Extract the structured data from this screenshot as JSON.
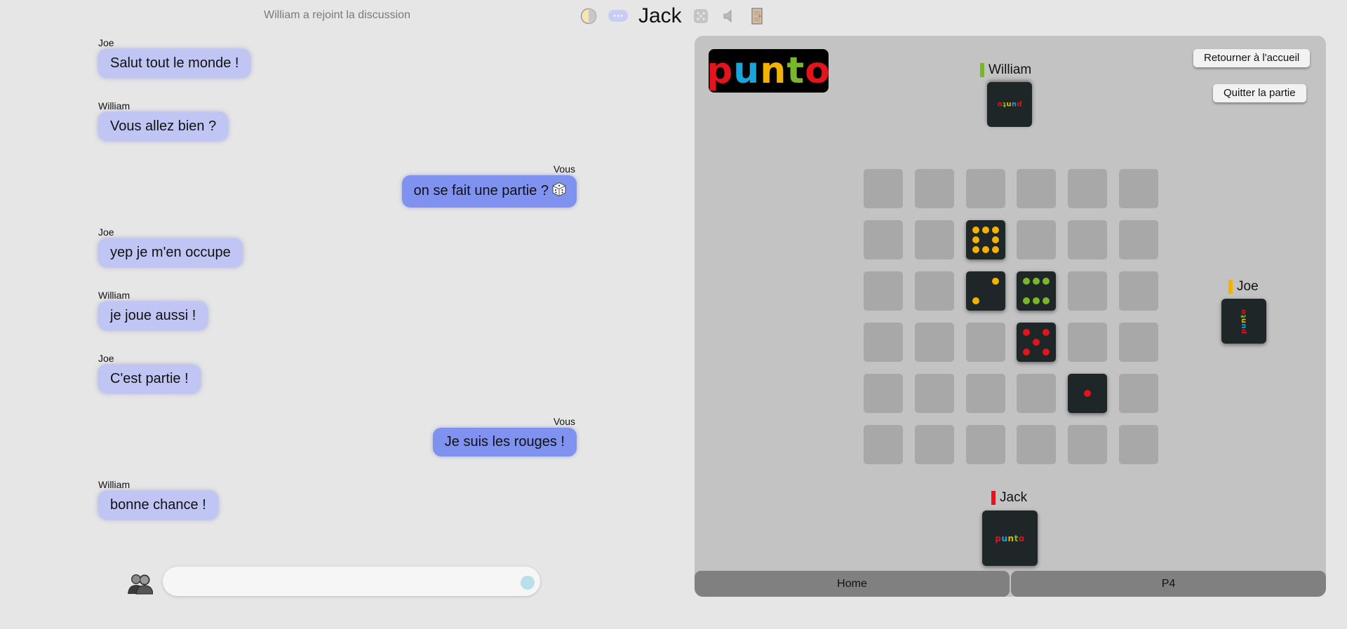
{
  "top": {
    "notice": "William a rejoint la discussion",
    "username": "Jack",
    "icons": [
      "theme-toggle-icon",
      "chat-bubble-icon",
      "dice-icon",
      "speaker-icon",
      "door-exit-icon"
    ]
  },
  "chat": {
    "messages": [
      {
        "author": "Joe",
        "text": "Salut tout le monde !",
        "mine": false
      },
      {
        "author": "William",
        "text": "Vous allez bien ?",
        "mine": false
      },
      {
        "author": "Vous",
        "text": "on se fait une partie ?",
        "mine": true,
        "emoji": "dice-icon"
      },
      {
        "author": "Joe",
        "text": "yep je m'en occupe",
        "mine": false
      },
      {
        "author": "William",
        "text": "je joue aussi !",
        "mine": false
      },
      {
        "author": "Joe",
        "text": "C'est partie !",
        "mine": false
      },
      {
        "author": "Vous",
        "text": "Je suis les rouges !",
        "mine": true
      },
      {
        "author": "William",
        "text": "bonne chance !",
        "mine": false
      }
    ],
    "input": {
      "value": "",
      "placeholder": ""
    },
    "colors": {
      "their_bubble": "#c0c5f3",
      "my_bubble": "#7f92f0"
    }
  },
  "game": {
    "logo": "punto",
    "buttons": {
      "home": "Retourner à l'accueil",
      "quit": "Quitter la partie"
    },
    "players": {
      "top": {
        "name": "William",
        "color": "#78b62a"
      },
      "right": {
        "name": "Joe",
        "color": "#f2b200"
      },
      "bottom": {
        "name": "Jack",
        "color": "#e3141b"
      }
    },
    "card_back_text": "punto",
    "board": {
      "rows": 6,
      "cols": 6,
      "cards": [
        {
          "row": 2,
          "col": 3,
          "value": 8,
          "color": "yellow"
        },
        {
          "row": 3,
          "col": 3,
          "value": 2,
          "color": "yellow"
        },
        {
          "row": 3,
          "col": 4,
          "value": 6,
          "color": "green"
        },
        {
          "row": 4,
          "col": 4,
          "value": 5,
          "color": "red"
        },
        {
          "row": 5,
          "col": 5,
          "value": 1,
          "color": "red"
        }
      ]
    },
    "tabs": [
      "Home",
      "P4"
    ]
  },
  "palette": {
    "red": "#e3141b",
    "blue": "#1ba4dc",
    "yellow": "#f2b200",
    "green": "#78b62a"
  }
}
